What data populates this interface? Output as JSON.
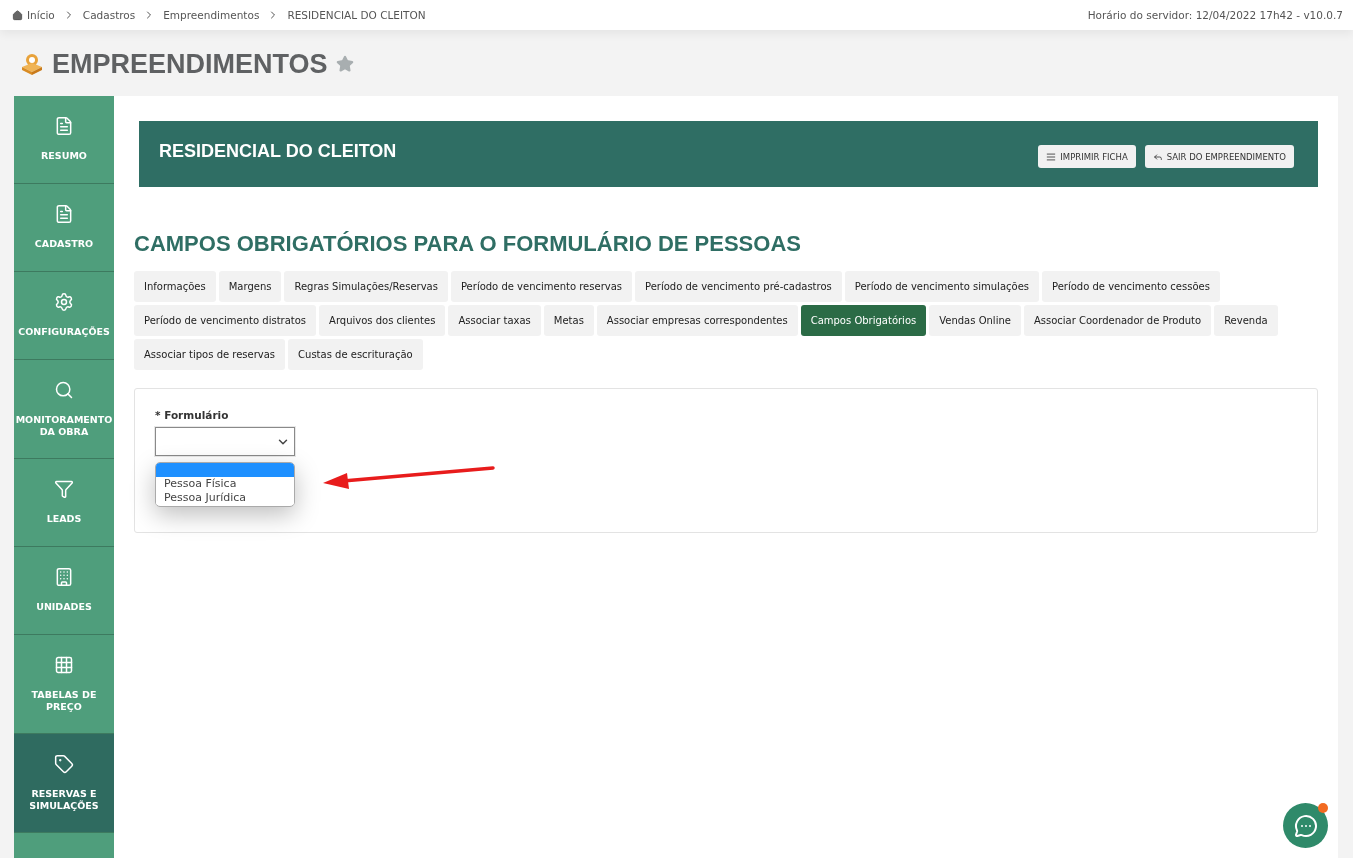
{
  "breadcrumb": {
    "items": [
      "Início",
      "Cadastros",
      "Empreendimentos",
      "RESIDENCIAL DO CLEITON"
    ]
  },
  "server_time": "Horário do servidor: 12/04/2022 17h42 - v10.0.7",
  "page_title": {
    "text": "EMPREENDIMENTOS",
    "favorite": false
  },
  "sidebar": {
    "items": [
      {
        "label": "RESUMO",
        "selected": false
      },
      {
        "label": "CADASTRO",
        "selected": false
      },
      {
        "label": "CONFIGURAÇÕES",
        "selected": false
      },
      {
        "label": "MONITORAMENTO DA OBRA",
        "selected": false
      },
      {
        "label": "LEADS",
        "selected": false
      },
      {
        "label": "UNIDADES",
        "selected": false
      },
      {
        "label": "TABELAS DE PREÇO",
        "selected": false
      },
      {
        "label": "RESERVAS E SIMULAÇÕES",
        "selected": true
      }
    ]
  },
  "header": {
    "title": "RESIDENCIAL DO CLEITON",
    "buttons": [
      {
        "label": "IMPRIMIR FICHA"
      },
      {
        "label": "SAIR DO EMPREENDIMENTO"
      }
    ]
  },
  "section_title": "CAMPOS OBRIGATÓRIOS PARA O FORMULÁRIO DE PESSOAS",
  "tab_rows": [
    {
      "tabs": [
        {
          "label": "Informações",
          "selected": false
        },
        {
          "label": "Margens",
          "selected": false
        },
        {
          "label": "Regras Simulações/Reservas",
          "selected": false
        },
        {
          "label": "Período de vencimento reservas",
          "selected": false
        },
        {
          "label": "Período de vencimento pré-cadastros",
          "selected": false
        },
        {
          "label": "Período de vencimento simulações",
          "selected": false
        },
        {
          "label": "Período de vencimento cessões",
          "selected": false
        }
      ]
    },
    {
      "tabs": [
        {
          "label": "Período de vencimento distratos",
          "selected": false
        },
        {
          "label": "Arquivos dos clientes",
          "selected": false
        },
        {
          "label": "Associar taxas",
          "selected": false
        },
        {
          "label": "Metas",
          "selected": false
        },
        {
          "label": "Associar empresas correspondentes",
          "selected": false
        },
        {
          "label": "Campos Obrigatórios",
          "selected": true
        },
        {
          "label": "Vendas Online",
          "selected": false
        },
        {
          "label": "Associar Coordenador de Produto",
          "selected": false
        },
        {
          "label": "Revenda",
          "selected": false
        }
      ]
    },
    {
      "tabs": [
        {
          "label": "Associar tipos de reservas",
          "selected": false
        },
        {
          "label": "Custas de escrituração",
          "selected": false
        }
      ]
    }
  ],
  "form": {
    "required_mark": "*",
    "label": "Formulário",
    "dropdown": {
      "expanded": true,
      "blank_highlighted": true,
      "options": [
        {
          "label": "Pessoa Física",
          "selected": false
        },
        {
          "label": "Pessoa Jurídica",
          "selected": false
        }
      ]
    }
  },
  "chat": {
    "unread": true
  }
}
